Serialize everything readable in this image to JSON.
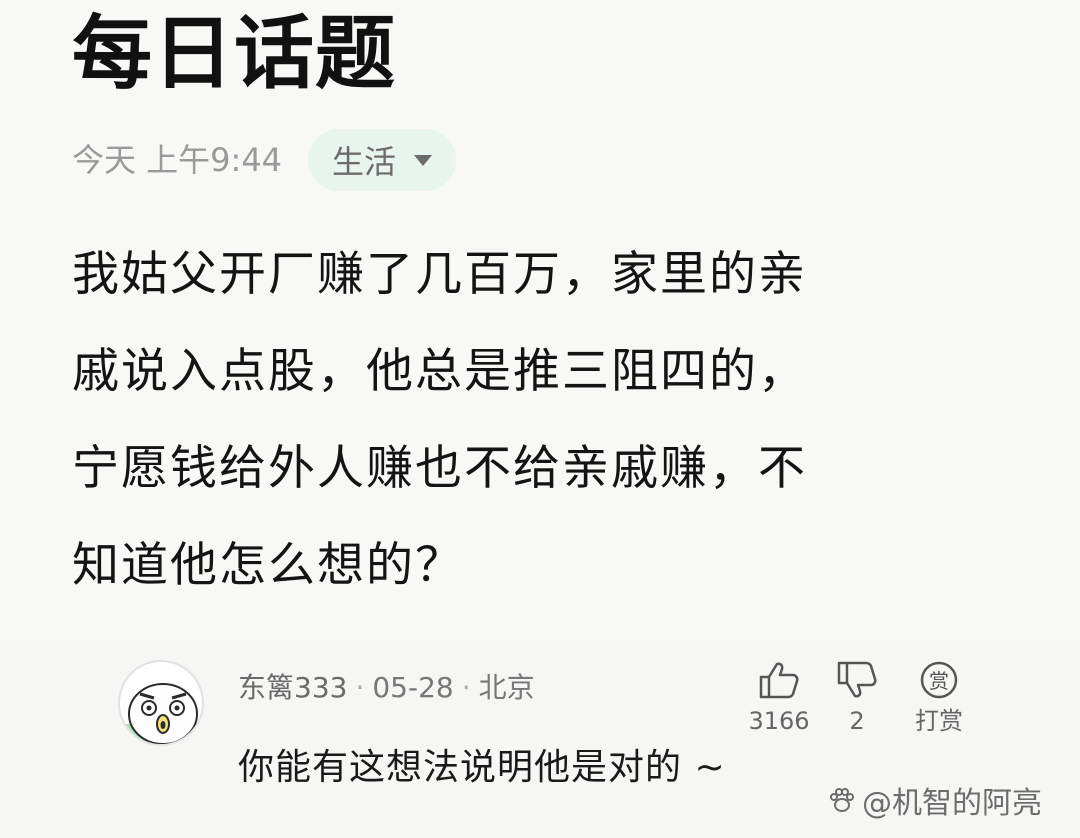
{
  "post": {
    "title": "每日话题",
    "time": "今天 上午9:44",
    "category": "生活",
    "question_lines": [
      "我姑父开厂赚了几百万，家里的亲",
      "戚说入点股，他总是推三阻四的，",
      "宁愿钱给外人赚也不给亲戚赚，不",
      "知道他怎么想的？"
    ]
  },
  "comment": {
    "author": "东篱333",
    "date": "05-28",
    "location": "北京",
    "separator": "·",
    "text": "你能有这想法说明他是对的 ~",
    "likes": "3166",
    "dislikes": "2",
    "reward_icon_char": "赏",
    "reward_label": "打赏"
  },
  "watermark": {
    "text": "@机智的阿亮"
  },
  "icons": {
    "thumb_up": "thumbs-up-icon",
    "thumb_down": "thumbs-down-icon",
    "reward": "reward-coin-icon",
    "caret": "caret-down-icon",
    "watermark_logo": "paw-logo-icon"
  },
  "colors": {
    "background": "#f8f8f6",
    "category_pill": "#e8f4ee",
    "muted_text": "#9a9a9a"
  }
}
